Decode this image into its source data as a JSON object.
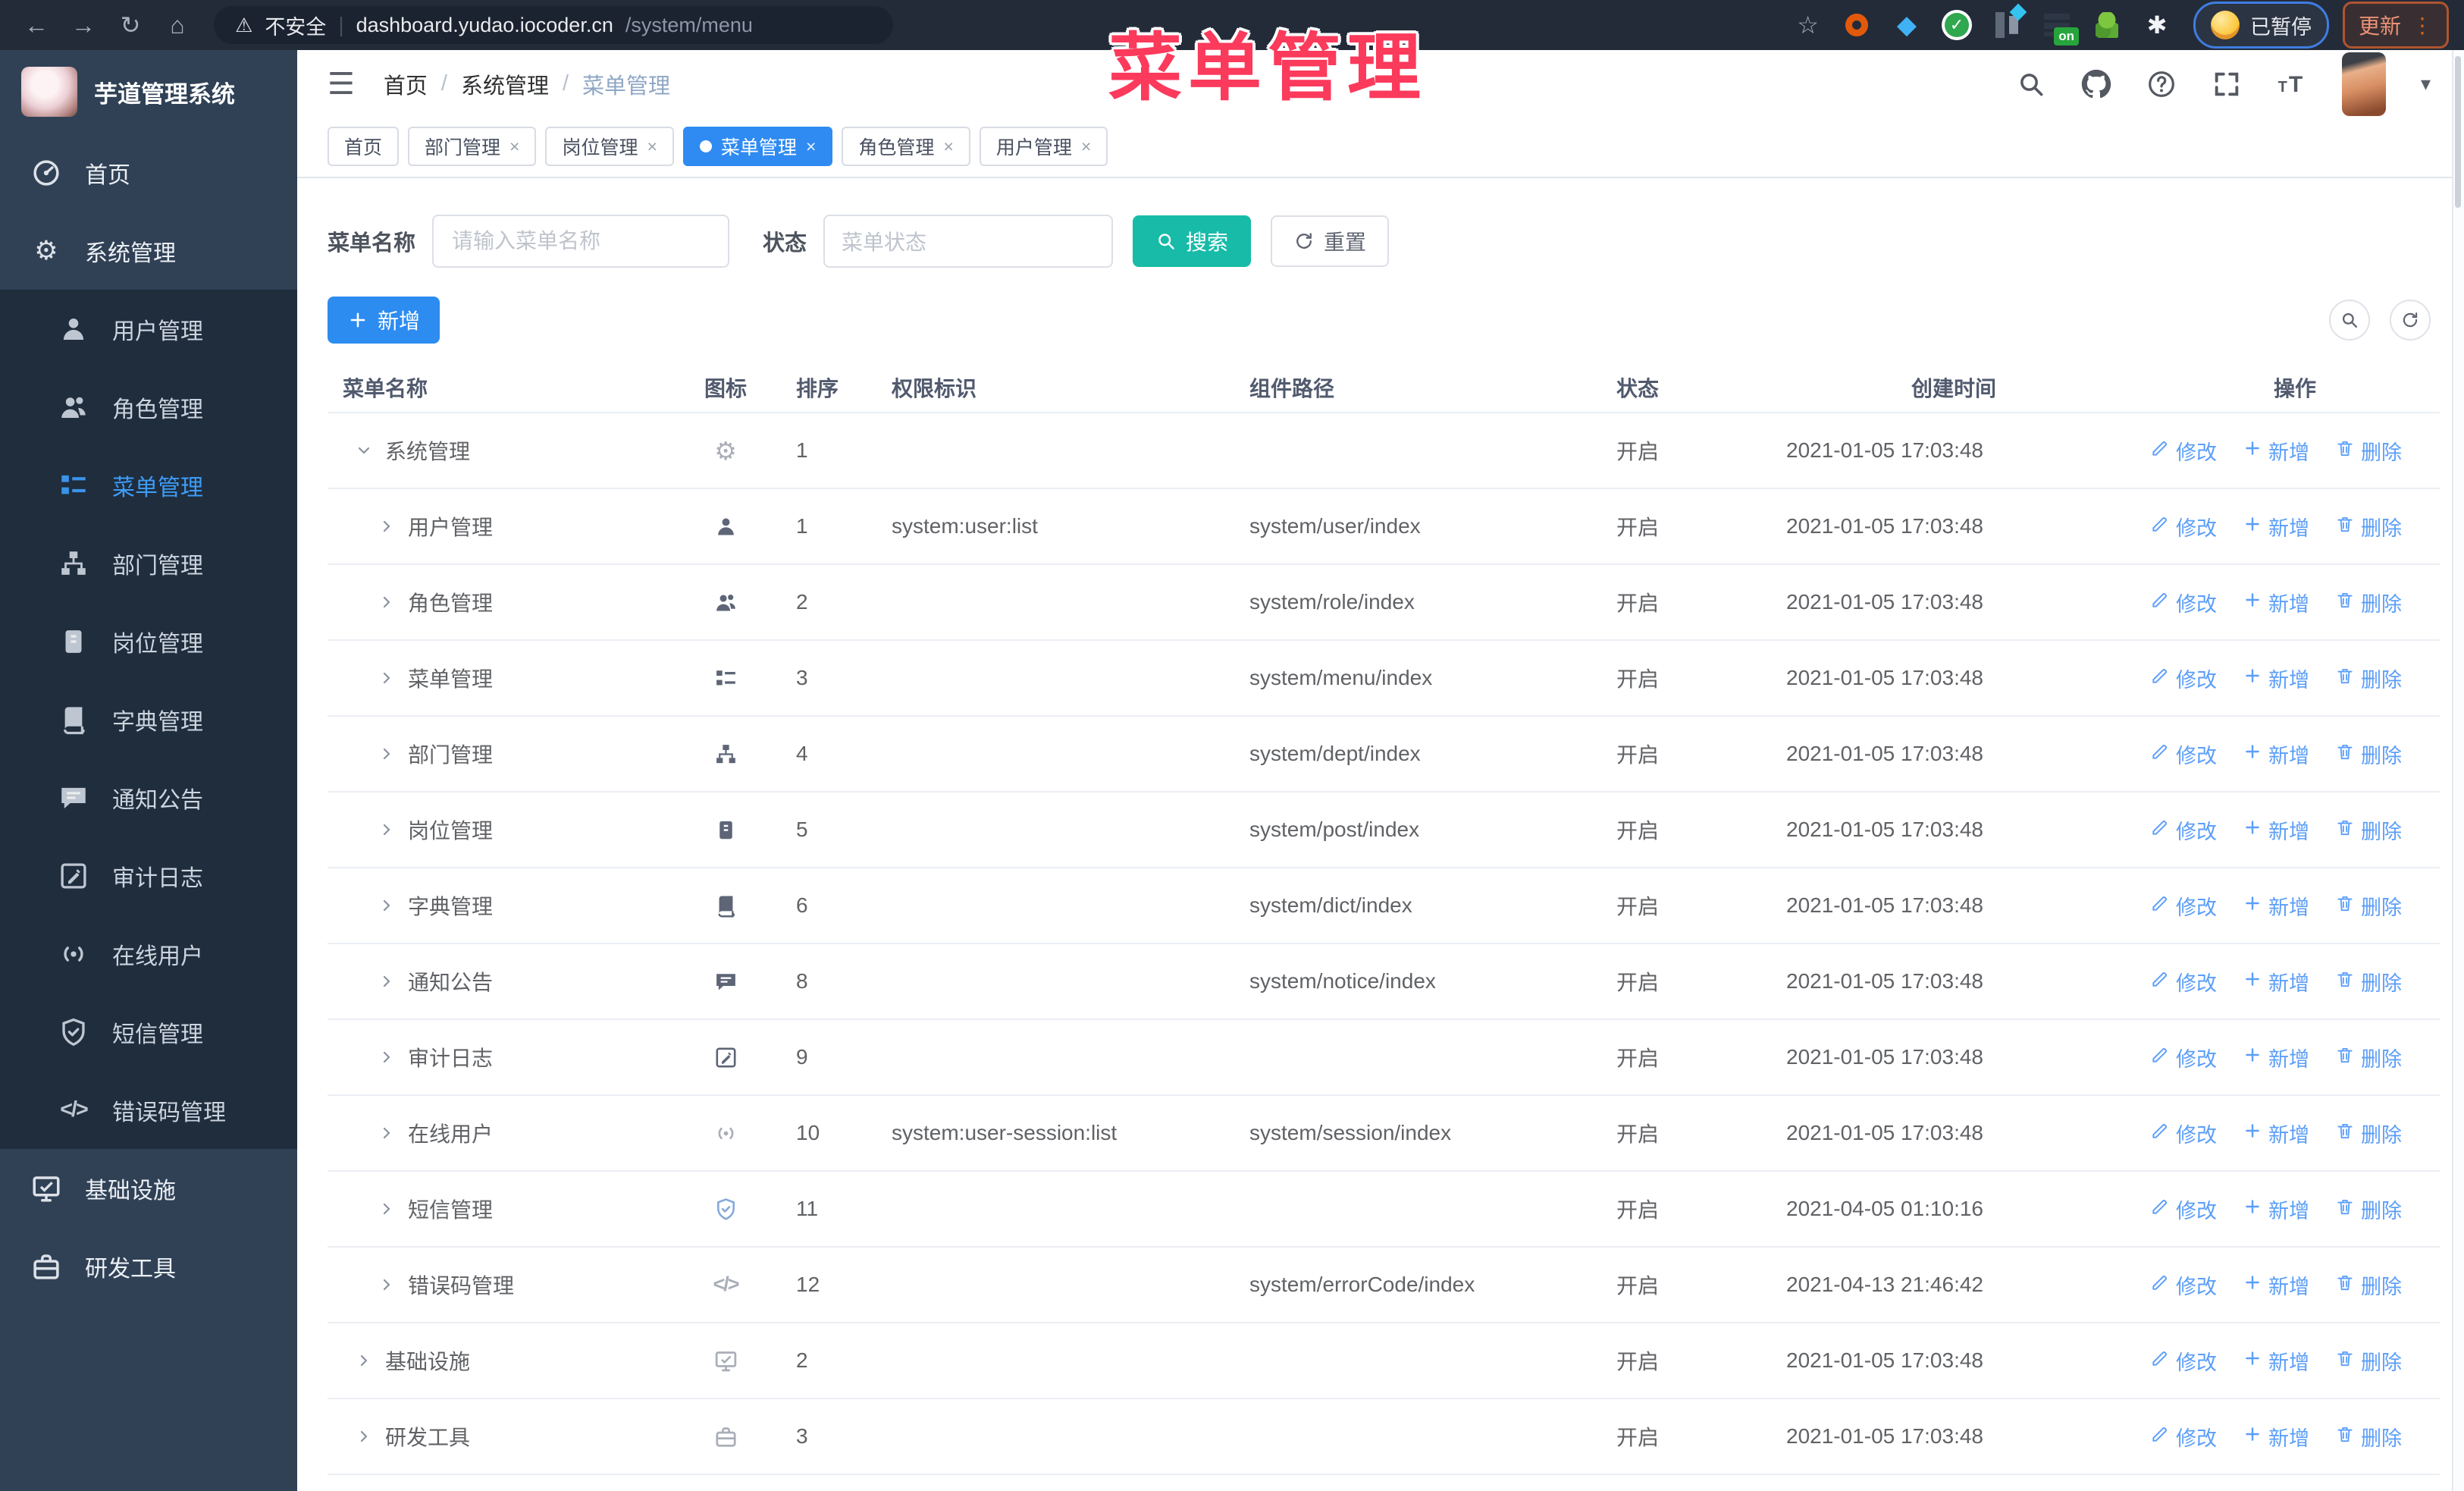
{
  "colors": {
    "sidebar_bg": "#304156",
    "submenu_bg": "#1f2d3d",
    "active_blue": "#3e9cf7",
    "tab_active": "#2f8bf2",
    "teal": "#18bba8",
    "add_blue": "#2d8cf0",
    "link_blue": "#5b9ef8",
    "watermark_red": "#fb3a5c"
  },
  "watermark": "菜单管理",
  "browser": {
    "security_label": "不安全",
    "url_host": "dashboard.yudao.iocoder.cn",
    "url_path": "/system/menu",
    "extension_on_badge": "on",
    "paused_badge": "已暂停",
    "update_button": "更新"
  },
  "sidebar": {
    "logo_title": "芋道管理系统",
    "items": [
      {
        "level": 1,
        "icon": "dashboard-icon",
        "label": "首页"
      },
      {
        "level": 1,
        "icon": "gear-icon",
        "label": "系统管理",
        "chevron": "up"
      },
      {
        "level": 2,
        "icon": "user-icon",
        "label": "用户管理"
      },
      {
        "level": 2,
        "icon": "users-icon",
        "label": "角色管理"
      },
      {
        "level": 2,
        "icon": "menu-icon",
        "label": "菜单管理",
        "active": true
      },
      {
        "level": 2,
        "icon": "tree-icon",
        "label": "部门管理"
      },
      {
        "level": 2,
        "icon": "post-icon",
        "label": "岗位管理"
      },
      {
        "level": 2,
        "icon": "dict-icon",
        "label": "字典管理"
      },
      {
        "level": 2,
        "icon": "notice-icon",
        "label": "通知公告"
      },
      {
        "level": 2,
        "icon": "log-icon",
        "label": "审计日志",
        "chevron": "down"
      },
      {
        "level": 2,
        "icon": "online-icon",
        "label": "在线用户"
      },
      {
        "level": 2,
        "icon": "shield-icon",
        "label": "短信管理",
        "chevron": "down"
      },
      {
        "level": 2,
        "icon": "code-icon",
        "label": "错误码管理"
      },
      {
        "level": 1,
        "icon": "monitor-icon",
        "label": "基础设施",
        "chevron": "down"
      },
      {
        "level": 1,
        "icon": "tool-icon",
        "label": "研发工具",
        "chevron": "down"
      }
    ]
  },
  "header": {
    "breadcrumb": [
      "首页",
      "系统管理",
      "菜单管理"
    ]
  },
  "tabs": [
    {
      "label": "首页",
      "closable": false,
      "active": false
    },
    {
      "label": "部门管理",
      "closable": true,
      "active": false
    },
    {
      "label": "岗位管理",
      "closable": true,
      "active": false
    },
    {
      "label": "菜单管理",
      "closable": true,
      "active": true
    },
    {
      "label": "角色管理",
      "closable": true,
      "active": false
    },
    {
      "label": "用户管理",
      "closable": true,
      "active": false
    }
  ],
  "filters": {
    "name_label": "菜单名称",
    "name_placeholder": "请输入菜单名称",
    "name_value": "",
    "status_label": "状态",
    "status_placeholder": "菜单状态",
    "search_button": "搜索",
    "reset_button": "重置"
  },
  "toolbar": {
    "add_button": "新增"
  },
  "table": {
    "columns": [
      "菜单名称",
      "图标",
      "排序",
      "权限标识",
      "组件路径",
      "状态",
      "创建时间",
      "操作"
    ],
    "rows": [
      {
        "name": "系统管理",
        "level": 0,
        "expand": "down",
        "icon": "gear-icon",
        "tone": "muted",
        "sort": "1",
        "perm": "",
        "path": "",
        "status": "开启",
        "time": "2021-01-05 17:03:48"
      },
      {
        "name": "用户管理",
        "level": 1,
        "expand": "right",
        "icon": "user-icon",
        "tone": "normal",
        "sort": "1",
        "perm": "system:user:list",
        "path": "system/user/index",
        "status": "开启",
        "time": "2021-01-05 17:03:48"
      },
      {
        "name": "角色管理",
        "level": 1,
        "expand": "right",
        "icon": "users-icon",
        "tone": "normal",
        "sort": "2",
        "perm": "",
        "path": "system/role/index",
        "status": "开启",
        "time": "2021-01-05 17:03:48"
      },
      {
        "name": "菜单管理",
        "level": 1,
        "expand": "right",
        "icon": "menu-icon",
        "tone": "normal",
        "sort": "3",
        "perm": "",
        "path": "system/menu/index",
        "status": "开启",
        "time": "2021-01-05 17:03:48"
      },
      {
        "name": "部门管理",
        "level": 1,
        "expand": "right",
        "icon": "tree-icon",
        "tone": "normal",
        "sort": "4",
        "perm": "",
        "path": "system/dept/index",
        "status": "开启",
        "time": "2021-01-05 17:03:48"
      },
      {
        "name": "岗位管理",
        "level": 1,
        "expand": "right",
        "icon": "post-icon",
        "tone": "normal",
        "sort": "5",
        "perm": "",
        "path": "system/post/index",
        "status": "开启",
        "time": "2021-01-05 17:03:48"
      },
      {
        "name": "字典管理",
        "level": 1,
        "expand": "right",
        "icon": "dict-icon",
        "tone": "normal",
        "sort": "6",
        "perm": "",
        "path": "system/dict/index",
        "status": "开启",
        "time": "2021-01-05 17:03:48"
      },
      {
        "name": "通知公告",
        "level": 1,
        "expand": "right",
        "icon": "notice-icon",
        "tone": "normal",
        "sort": "8",
        "perm": "",
        "path": "system/notice/index",
        "status": "开启",
        "time": "2021-01-05 17:03:48"
      },
      {
        "name": "审计日志",
        "level": 1,
        "expand": "right",
        "icon": "log-icon",
        "tone": "normal",
        "sort": "9",
        "perm": "",
        "path": "",
        "status": "开启",
        "time": "2021-01-05 17:03:48"
      },
      {
        "name": "在线用户",
        "level": 1,
        "expand": "right",
        "icon": "online-icon",
        "tone": "muted",
        "sort": "10",
        "perm": "system:user-session:list",
        "path": "system/session/index",
        "status": "开启",
        "time": "2021-01-05 17:03:48"
      },
      {
        "name": "短信管理",
        "level": 1,
        "expand": "right",
        "icon": "shield-icon",
        "tone": "blue",
        "sort": "11",
        "perm": "",
        "path": "",
        "status": "开启",
        "time": "2021-04-05 01:10:16"
      },
      {
        "name": "错误码管理",
        "level": 1,
        "expand": "right",
        "icon": "code-icon",
        "tone": "muted",
        "sort": "12",
        "perm": "",
        "path": "system/errorCode/index",
        "status": "开启",
        "time": "2021-04-13 21:46:42"
      },
      {
        "name": "基础设施",
        "level": 0,
        "expand": "right",
        "icon": "monitor-icon",
        "tone": "muted",
        "sort": "2",
        "perm": "",
        "path": "",
        "status": "开启",
        "time": "2021-01-05 17:03:48"
      },
      {
        "name": "研发工具",
        "level": 0,
        "expand": "right",
        "icon": "tool-icon",
        "tone": "muted",
        "sort": "3",
        "perm": "",
        "path": "",
        "status": "开启",
        "time": "2021-01-05 17:03:48"
      }
    ]
  },
  "row_actions": [
    {
      "label": "修改",
      "icon": "edit-icon",
      "name": "row-edit-link"
    },
    {
      "label": "新增",
      "icon": "plus-icon",
      "name": "row-add-link"
    },
    {
      "label": "删除",
      "icon": "delete-icon",
      "name": "row-delete-link"
    }
  ]
}
